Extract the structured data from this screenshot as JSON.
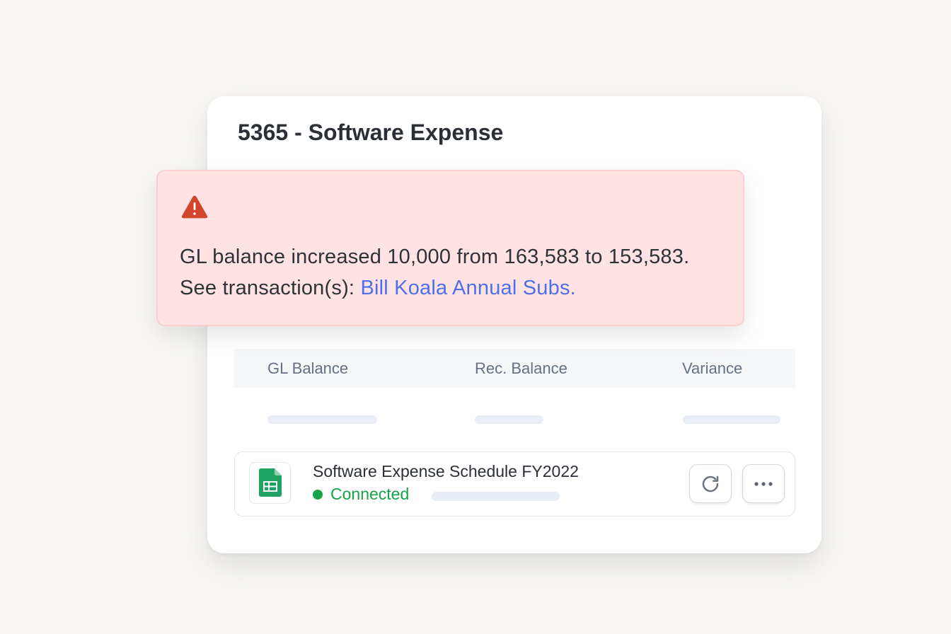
{
  "card": {
    "title": "5365 - Software Expense"
  },
  "alert": {
    "icon": "warning-triangle-icon",
    "message_prefix": "GL balance increased 10,000 from 163,583 to 153,583. See transaction(s): ",
    "link_text": "Bill Koala Annual Subs.",
    "color": "#ffe3e4",
    "icon_color": "#d2452c",
    "link_color": "#4f6fe8"
  },
  "table": {
    "columns": [
      "GL Balance",
      "Rec. Balance",
      "Variance"
    ]
  },
  "file": {
    "name": "Software Expense Schedule FY2022",
    "status": "Connected",
    "status_color": "#16a34a",
    "icon": "google-sheets-icon",
    "actions": {
      "refresh_icon": "refresh-icon",
      "more_icon": "more-horizontal-icon"
    }
  }
}
